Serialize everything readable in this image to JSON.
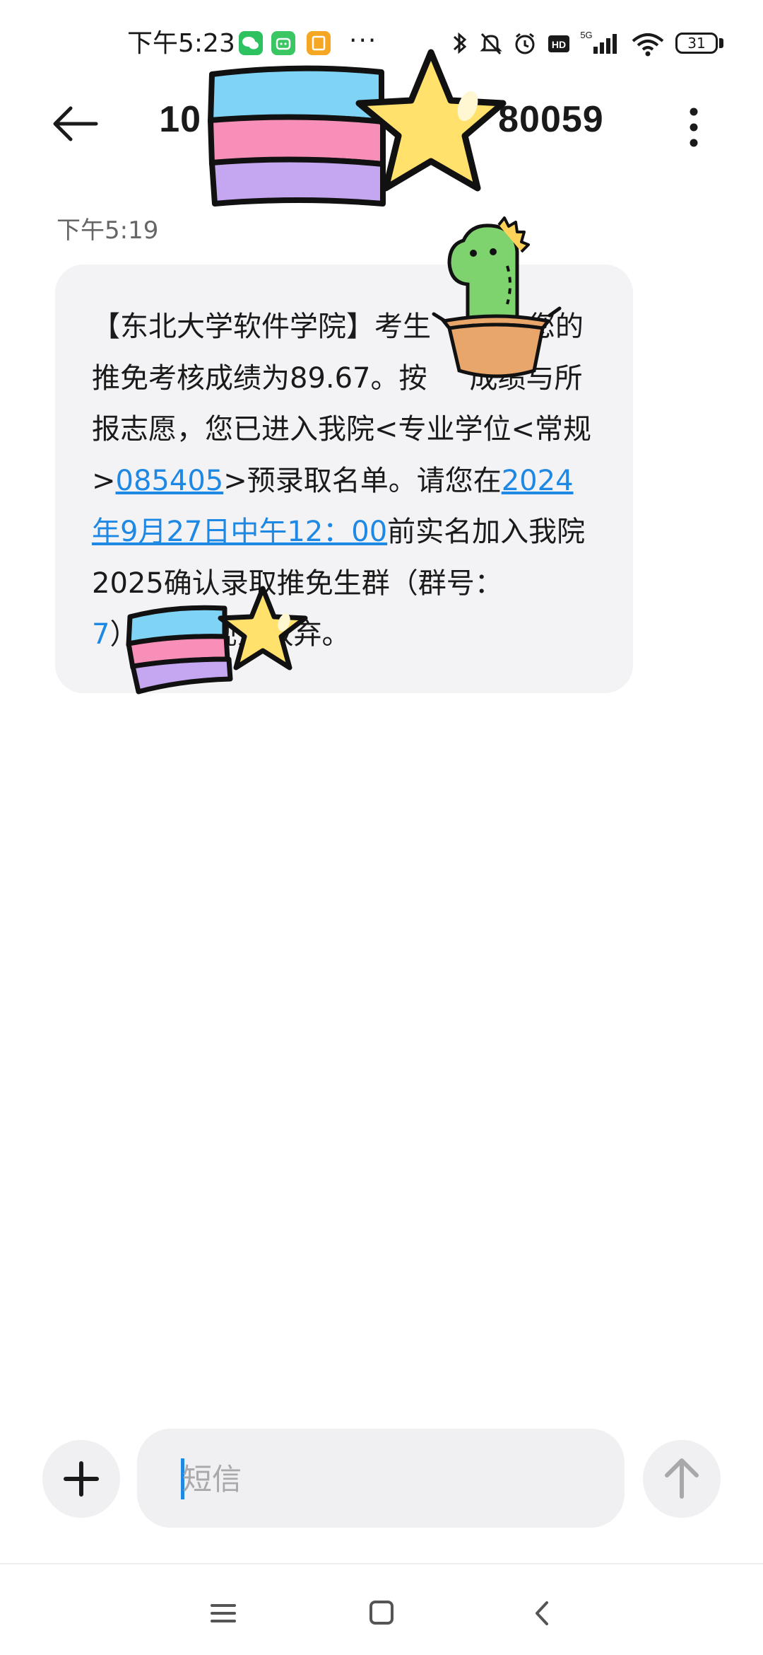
{
  "status_bar": {
    "time": "下午5:23",
    "dots": "···",
    "battery": "31",
    "network_label": "5G",
    "hd_label": "HD",
    "app_icons": [
      {
        "name": "wechat-icon",
        "color": "#2dc160"
      },
      {
        "name": "bilibili-icon",
        "color": "#3ac663"
      },
      {
        "name": "note-icon",
        "color": "#f5a623"
      }
    ]
  },
  "header": {
    "title": "10",
    "title_suffix": "80059"
  },
  "message": {
    "time": "下午5:19",
    "segments": {
      "s1": "【东北大学软件学院】考生",
      "s2": "，您的推免考核成绩为89.67。按",
      "s3": "成绩与所报志愿，您已进入我院<专业学位<常规>",
      "link1": "085405",
      "s4": ">预录取名单。请您在",
      "link2": "2024年9月27日中午12：00",
      "s5": "前实名加入我院2025确认录取推免生群（群号：",
      "s6": "7",
      "s7": "），逾期视为放弃。"
    }
  },
  "composer": {
    "placeholder": "短信"
  },
  "colors": {
    "link": "#1e88e5",
    "bubble": "#f3f3f5"
  }
}
